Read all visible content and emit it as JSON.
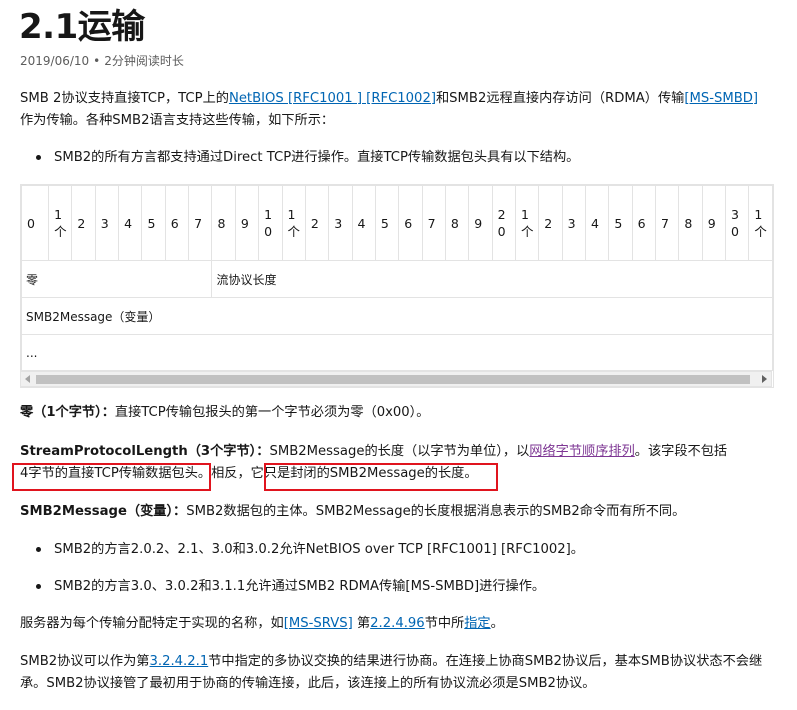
{
  "title": "2.1运输",
  "meta": {
    "date": "2019/06/10",
    "separator": "•",
    "read_time": "2分钟阅读时长"
  },
  "intro": {
    "text1": "SMB 2协议支持直接TCP，TCP上的",
    "link1": "NetBIOS [RFC1001 ] [RFC1002]",
    "text2": "和SMB2远程直接内存访问（RDMA）传输",
    "link2": "[MS-SMBD]",
    "text3": "作为传输。各种SMB2语言支持这些传输，如下所示："
  },
  "bullet1": "SMB2的所有方言都支持通过Direct TCP进行操作。直接TCP传输数据包头具有以下结构。",
  "table": {
    "bit_headers": [
      "0",
      "1\n个",
      "2",
      "3",
      "4",
      "5",
      "6",
      "7",
      "8",
      "9",
      "1\n0",
      "1\n个",
      "2",
      "3",
      "4",
      "5",
      "6",
      "7",
      "8",
      "9",
      "2\n0",
      "1\n个",
      "2",
      "3",
      "4",
      "5",
      "6",
      "7",
      "8",
      "9",
      "3\n0",
      "1\n个"
    ],
    "row1_col1": "零",
    "row1_col2": "流协议长度",
    "row2": "SMB2Message（变量）",
    "row3": "..."
  },
  "def_zero": {
    "term": "零（1个字节）：",
    "text": "直接TCP传输包报头的第一个字节必须为零（0x00）。"
  },
  "def_len": {
    "term": "StreamProtocolLength（3个字节）：",
    "text1": "SMB2Message的长度（以字节为单位），以",
    "link": "网络字节顺序排列",
    "text2": "。该字段不包括",
    "highlight1": "4字节的直接TCP传输数据包头",
    "text3": "。相反，",
    "highlight2": "它只是封闭的SMB2Message的长度。"
  },
  "def_msg": {
    "term": "SMB2Message（变量）：",
    "text": "SMB2数据包的主体。SMB2Message的长度根据消息表示的SMB2命令而有所不同。"
  },
  "bullet2": "SMB2的方言2.0.2、2.1、3.0和3.0.2允许NetBIOS over TCP [RFC1001] [RFC1002]。",
  "bullet3": "SMB2的方言3.0、3.0.2和3.1.1允许通过SMB2 RDMA传输[MS-SMBD]进行操作。",
  "para_server": {
    "text1": "服务器为每个传输分配特定于实现的名称，如",
    "link1": "[MS-SRVS]",
    "text2": " 第",
    "link2": "2.2.4.96",
    "text3": "节中所",
    "link3": "指定",
    "text4": "。"
  },
  "para_protocol": {
    "text1": "SMB2协议可以作为第",
    "link": "3.2.4.2.1",
    "text2": "节中指定的多协议交换的结果进行协商。在连接上协商SMB2协议后，基本SMB协议状态不会继承。SMB2协议接管了最初用于协商的传输连接，此后，该连接上的所有协议流必须是SMB2协议。"
  },
  "colors": {
    "link": "#0065b3",
    "visited_link": "#7e3794",
    "highlight_box": "#e0141e"
  }
}
